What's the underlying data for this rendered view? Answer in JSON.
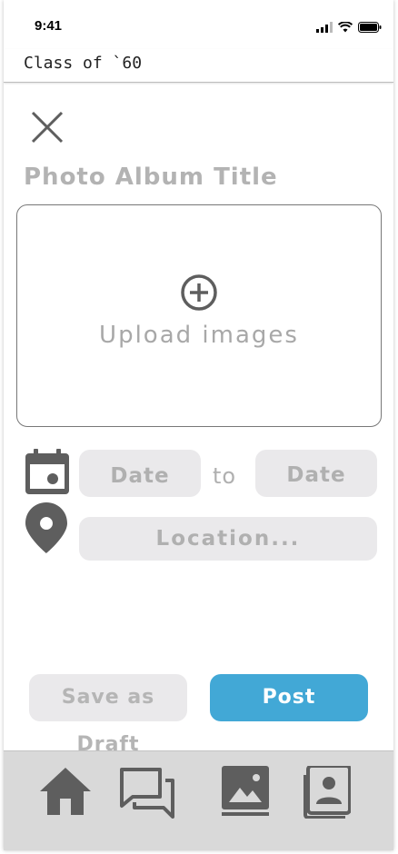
{
  "status_bar": {
    "time": "9:41"
  },
  "header": {
    "title": "Class of `60"
  },
  "form": {
    "album_title_placeholder": "Photo Album Title",
    "upload_label": "Upload images",
    "date_start": "Date",
    "date_separator": "to",
    "date_end": "Date",
    "location_placeholder": "Location..."
  },
  "actions": {
    "save_draft_label": "Save as Draft",
    "post_label": "Post"
  },
  "tab_bar": {
    "items": [
      {
        "icon": "home-icon"
      },
      {
        "icon": "chat-icon"
      },
      {
        "icon": "photos-icon"
      },
      {
        "icon": "contacts-icon"
      }
    ]
  },
  "colors": {
    "accent": "#42a8d6",
    "pill_bg": "#eae9eb",
    "placeholder_text": "#b0b0b0",
    "icon_gray": "#5e5e5e",
    "tab_bar_bg": "#d9d9d9"
  }
}
